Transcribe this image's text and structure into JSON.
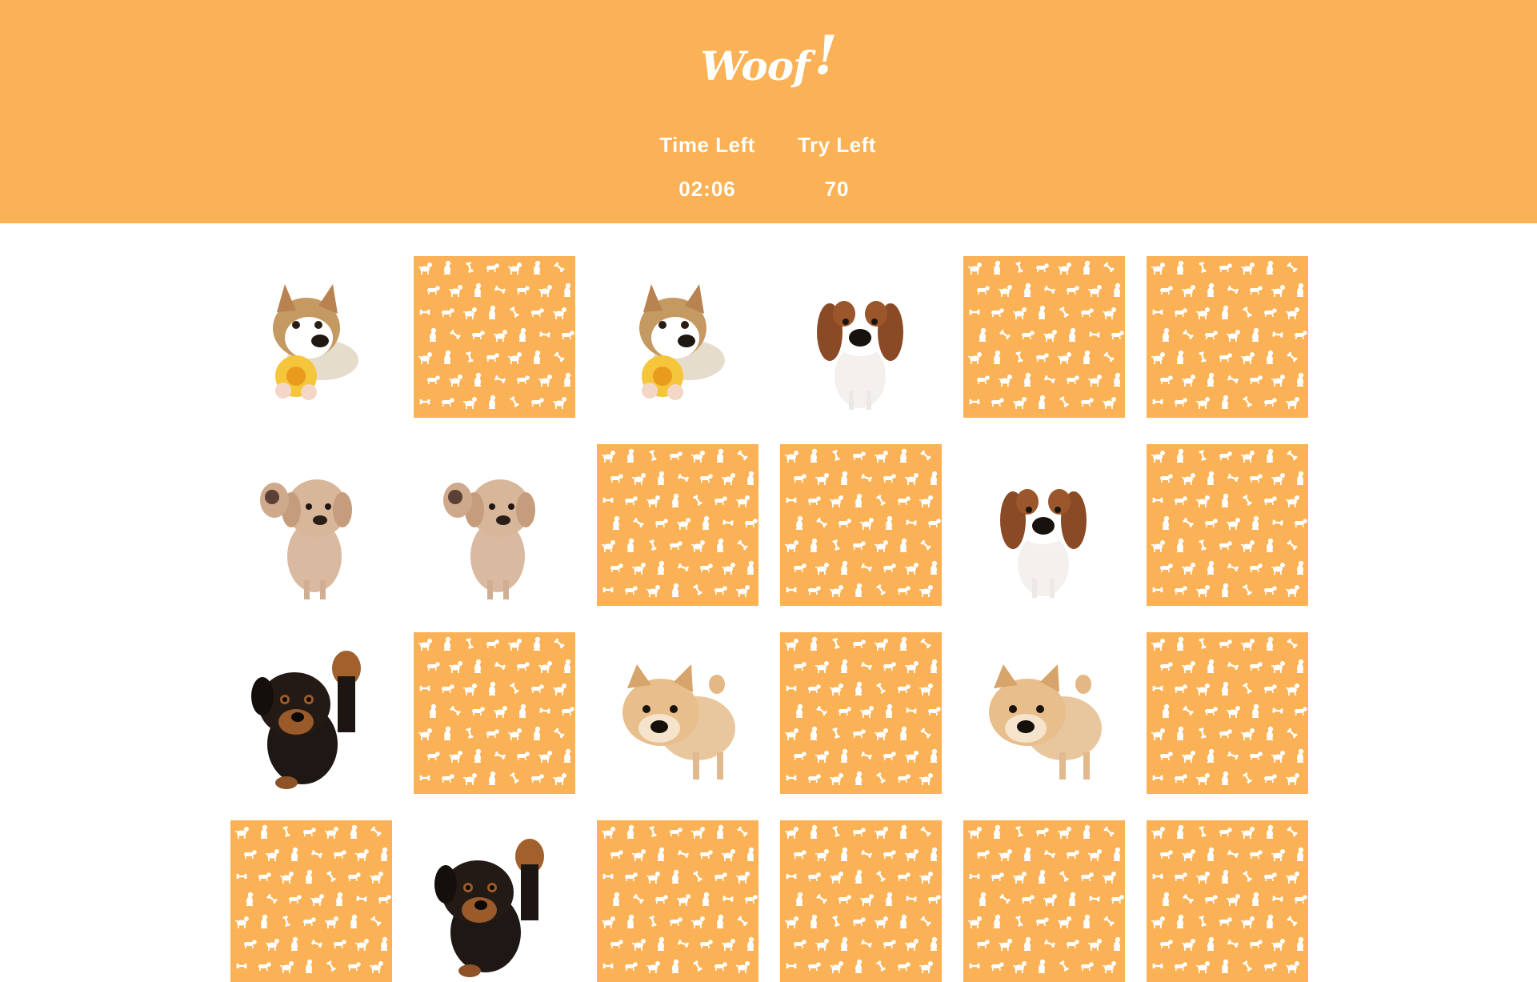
{
  "header": {
    "logo_text": "Woof",
    "logo_mark": "!",
    "time_label": "Time Left",
    "time_value": "02:06",
    "tries_label": "Try Left",
    "tries_value": "70"
  },
  "colors": {
    "accent": "#fbb155",
    "pattern": "#ffffff",
    "background": "#ffffff"
  },
  "board": {
    "columns": 6,
    "cards": [
      {
        "state": "revealed",
        "dog": "corgi-with-flower"
      },
      {
        "state": "hidden",
        "dog": ""
      },
      {
        "state": "revealed",
        "dog": "corgi-with-flower"
      },
      {
        "state": "revealed",
        "dog": "cavalier-spaniel"
      },
      {
        "state": "hidden",
        "dog": ""
      },
      {
        "state": "hidden",
        "dog": ""
      },
      {
        "state": "revealed",
        "dog": "golden-puppy-waving"
      },
      {
        "state": "revealed",
        "dog": "golden-puppy-waving"
      },
      {
        "state": "hidden",
        "dog": ""
      },
      {
        "state": "hidden",
        "dog": ""
      },
      {
        "state": "revealed",
        "dog": "cavalier-spaniel"
      },
      {
        "state": "hidden",
        "dog": ""
      },
      {
        "state": "revealed",
        "dog": "rottweiler-puppy"
      },
      {
        "state": "hidden",
        "dog": ""
      },
      {
        "state": "revealed",
        "dog": "shiba-puppy"
      },
      {
        "state": "hidden",
        "dog": ""
      },
      {
        "state": "revealed",
        "dog": "shiba-puppy"
      },
      {
        "state": "hidden",
        "dog": ""
      },
      {
        "state": "hidden",
        "dog": ""
      },
      {
        "state": "revealed",
        "dog": "rottweiler-puppy"
      },
      {
        "state": "hidden",
        "dog": ""
      },
      {
        "state": "hidden",
        "dog": ""
      },
      {
        "state": "hidden",
        "dog": ""
      },
      {
        "state": "hidden",
        "dog": ""
      }
    ]
  }
}
